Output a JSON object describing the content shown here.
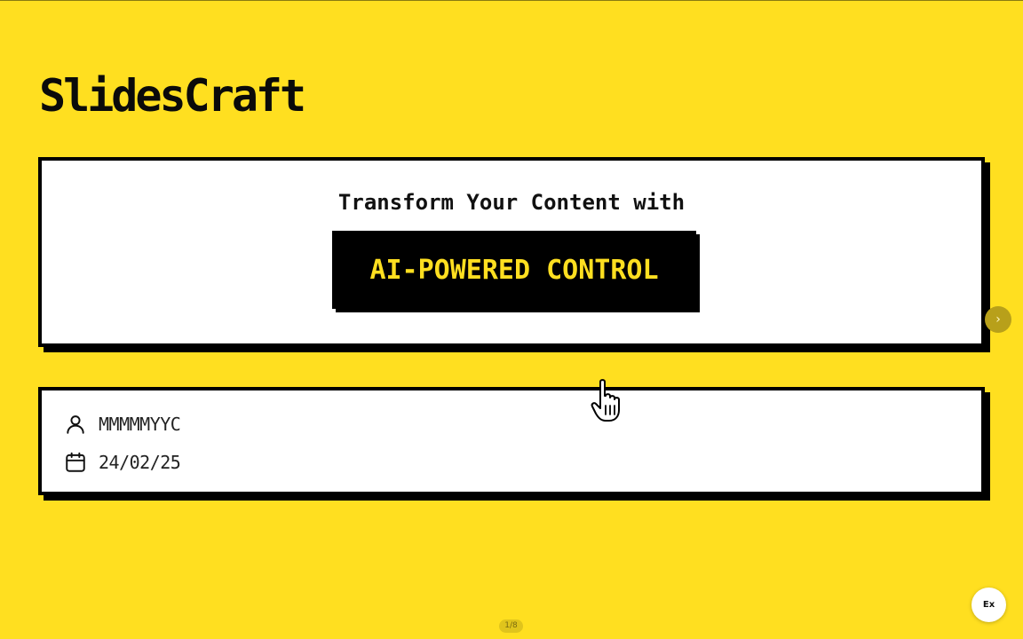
{
  "brand": {
    "name": "SlidesCraft"
  },
  "hero": {
    "subtitle": "Transform Your Content with",
    "highlight": "AI-POWERED CONTROL"
  },
  "meta": {
    "author": "MMMMMYYC",
    "date": "24/02/25",
    "author_icon": "user-icon",
    "date_icon": "calendar-icon"
  },
  "navigation": {
    "next_icon": "›",
    "page_indicator": "1/8",
    "ex_label": "Ex"
  },
  "colors": {
    "background": "#FFDF20",
    "card": "#FFFFFF",
    "border": "#000000",
    "highlight_bg": "#000000",
    "highlight_text": "#FFDF20"
  }
}
